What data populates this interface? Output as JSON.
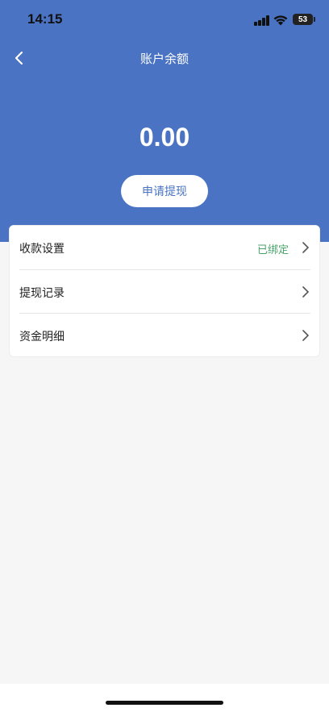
{
  "status_bar": {
    "time": "14:15",
    "battery": "53",
    "icons": [
      "signal-icon",
      "wifi-icon",
      "battery-icon"
    ]
  },
  "nav": {
    "title": "账户余额",
    "back_icon": "chevron-left-icon"
  },
  "balance": {
    "amount": "0.00"
  },
  "actions": {
    "withdraw_label": "申请提现"
  },
  "menu": {
    "items": [
      {
        "label": "收款设置",
        "status": "已绑定",
        "icon": "chevron-right-icon"
      },
      {
        "label": "提现记录",
        "icon": "chevron-right-icon"
      },
      {
        "label": "资金明细",
        "icon": "chevron-right-icon"
      }
    ]
  },
  "colors": {
    "header": "#4a73c4",
    "status_bound": "#4aa36a",
    "background": "#f6f6f6"
  }
}
